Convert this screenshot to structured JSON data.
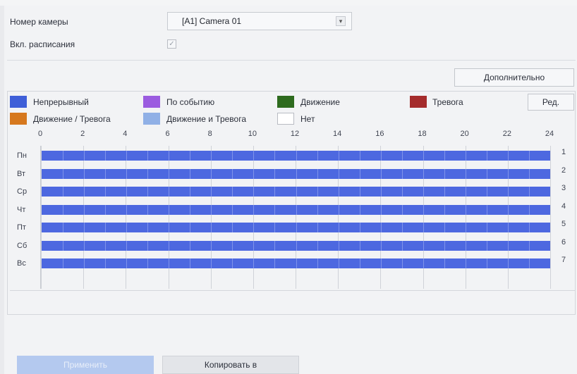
{
  "camera": {
    "label": "Номер камеры",
    "value": "[A1] Camera 01",
    "arrow_glyph": "▾"
  },
  "schedule_enable": {
    "label": "Вкл. расписания",
    "checked": true,
    "check_glyph": "✓"
  },
  "buttons": {
    "advanced": "Дополнительно",
    "edit": "Ред.",
    "apply": "Применить",
    "copy_to": "Копировать в"
  },
  "legend": [
    {
      "label": "Непрерывный",
      "color": "#3f5fd8"
    },
    {
      "label": "По событию",
      "color": "#9b5ce0"
    },
    {
      "label": "Движение",
      "color": "#2e6b1e"
    },
    {
      "label": "Тревога",
      "color": "#a52c2c"
    },
    {
      "label": "Движение / Тревога",
      "color": "#d6781e"
    },
    {
      "label": "Движение и Тревога",
      "color": "#90b0e6"
    },
    {
      "label": "Нет",
      "color": "#ffffff"
    }
  ],
  "hours": [
    "0",
    "2",
    "4",
    "6",
    "8",
    "10",
    "12",
    "14",
    "16",
    "18",
    "20",
    "22",
    "24"
  ],
  "days": [
    {
      "name": "Пн",
      "num": "1",
      "mode": "Непрерывный"
    },
    {
      "name": "Вт",
      "num": "2",
      "mode": "Непрерывный"
    },
    {
      "name": "Ср",
      "num": "3",
      "mode": "Непрерывный"
    },
    {
      "name": "Чт",
      "num": "4",
      "mode": "Непрерывный"
    },
    {
      "name": "Пт",
      "num": "5",
      "mode": "Непрерывный"
    },
    {
      "name": "Сб",
      "num": "6",
      "mode": "Непрерывный"
    },
    {
      "name": "Вс",
      "num": "7",
      "mode": "Непрерывный"
    }
  ]
}
